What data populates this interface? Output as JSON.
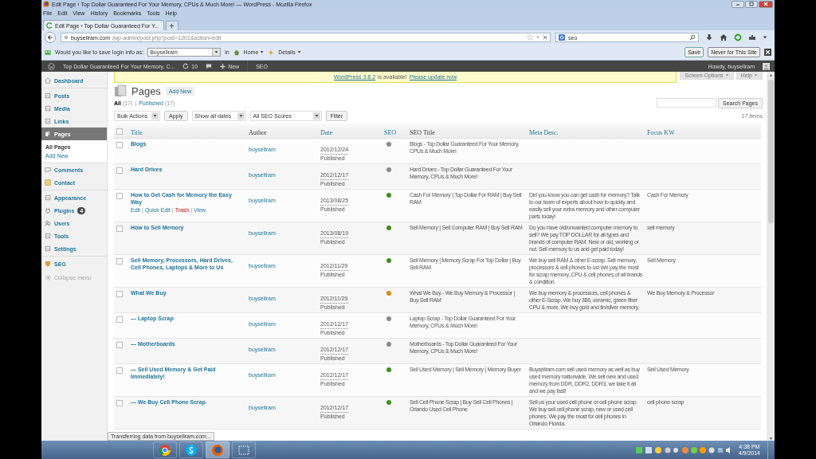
{
  "browser": {
    "title": "Edit Page ‹ Top Dollar Guaranteed For Your Memory, CPUs & Much More! — WordPress - Mozilla Firefox",
    "menu": [
      "File",
      "Edit",
      "View",
      "History",
      "Bookmarks",
      "Tools",
      "Help"
    ],
    "tab": {
      "label": "Edit Page ‹ Top Dollar Guaranteed For Y..."
    },
    "url": {
      "host": "buysellram.com",
      "path": "/wp-admin/post.php?post=1201&action=edit"
    },
    "search": {
      "value": "seo"
    }
  },
  "password_bar": {
    "prompt": "Would you like to save login info as:",
    "username": "Buysellram",
    "in": "in",
    "home": "Home",
    "details": "Details",
    "save": "Save",
    "never": "Never for This Site"
  },
  "admin_bar": {
    "site": "Top Dollar Guaranteed For Your Memory, C...",
    "updates": "10",
    "new": "New",
    "seo": "SEO",
    "howdy": "Howdy, buysellram"
  },
  "sidebar": {
    "groups": [
      {
        "items": [
          {
            "label": "Dashboard",
            "selected": false
          }
        ]
      },
      {
        "items": [
          {
            "label": "Posts",
            "selected": false
          },
          {
            "label": "Media",
            "selected": false
          },
          {
            "label": "Links",
            "selected": false
          },
          {
            "label": "Pages",
            "selected": true,
            "children": [
              {
                "label": "All Pages",
                "selected": true
              },
              {
                "label": "Add New",
                "selected": false
              }
            ]
          },
          {
            "label": "Comments",
            "selected": false
          },
          {
            "label": "Contact",
            "selected": false
          }
        ]
      },
      {
        "items": [
          {
            "label": "Appearance",
            "selected": false
          },
          {
            "label": "Plugins",
            "selected": false,
            "badge": "4"
          },
          {
            "label": "Users",
            "selected": false
          },
          {
            "label": "Tools",
            "selected": false
          },
          {
            "label": "Settings",
            "selected": false
          }
        ]
      },
      {
        "items": [
          {
            "label": "SEO",
            "selected": false
          }
        ]
      }
    ],
    "collapse": "Collapse menu"
  },
  "notice": {
    "version_link": "WordPress 3.8.2",
    "text": "is available!",
    "update_link": "Please update now"
  },
  "screen_options": "Screen Options",
  "help": "Help",
  "page": {
    "title": "Pages",
    "add_new": "Add New",
    "separator": "|",
    "views": [
      {
        "label": "All",
        "count": "(17)",
        "selected": true
      },
      {
        "label": "Published",
        "count": "(17)",
        "selected": false
      }
    ],
    "bulk": "Bulk Actions",
    "apply": "Apply",
    "dates": "Show all dates",
    "seo_filter": "All SEO Scores",
    "filter": "Filter",
    "search_button": "Search Pages",
    "items": "17 items"
  },
  "table": {
    "select_all_checked": false,
    "columns": [
      {
        "label": "Title",
        "sortable": true
      },
      {
        "label": "Author",
        "sortable": false
      },
      {
        "label": "Date",
        "sortable": true
      },
      {
        "label": "SEO",
        "sortable": true
      },
      {
        "label": "SEO Title",
        "sortable": false
      },
      {
        "label": "Meta Desc.",
        "sortable": true
      },
      {
        "label": "Focus KW",
        "sortable": true
      }
    ],
    "rows": [
      {
        "title": "Blogs",
        "checked": false,
        "author": "buysellram",
        "date": "2012/12/24",
        "status": "Published",
        "color": "#8a8a8a",
        "seo_title": "Blogs - Top Dollar Guaranteed For Your Memory, CPUs & Much More!"
      },
      {
        "title": "Hard Drives",
        "checked": false,
        "author": "buysellram",
        "date": "2012/12/17",
        "status": "Published",
        "color": "#8a8a8a",
        "seo_title": "Hard Drives - Top Dollar Guaranteed For Your Memory, CPUs & Much More!"
      },
      {
        "title": "How to Get Cash for Memory the Easy Way",
        "checked": false,
        "author": "buysellram",
        "date": "2013/08/25",
        "status": "Published",
        "color": "#3f8f1f",
        "seo_title": "Cash For Memory | Top Dollar For RAM | Buy Sell RAM",
        "meta": "Did you know you can get cash for memory? Talk to our team of experts about how to quickly and easily sell your extra memory and other computer parts today!",
        "focus": "Cash For Memory",
        "actions": [
          {
            "label": "Edit",
            "kind": "normal"
          },
          {
            "label": "Quick Edit",
            "kind": "normal"
          },
          {
            "label": "Trash",
            "kind": "danger"
          },
          {
            "label": "View",
            "kind": "normal"
          }
        ],
        "separator": "|"
      },
      {
        "title": "How to Sell Memory",
        "checked": false,
        "author": "buysellram",
        "date": "2013/08/19",
        "status": "Published",
        "color": "#3f8f1f",
        "seo_title": "Sell Memory | Sell Computer RAM | Buy Sell RAM",
        "meta": "Do you have old/unwanted computer memory to sell? We pay TOP DOLLAR for all types and brands of computer RAM. New or old, working or not. Sell memory to us and get paid today!",
        "focus": "sell memory"
      },
      {
        "title": "Sell Memory, Processors, Hard Drives, Cell Phones, Laptops & More to Us",
        "checked": false,
        "author": "buysellram",
        "date": "2012/11/29",
        "status": "Published",
        "color": "#3f8f1f",
        "seo_title": "Sell Memory | Memory Scrap For Top Dollar | Buy Sell RAM",
        "meta": "We buy sell RAM & other E-scrap. Sell memory, processors & cell phones to us! We pay the most for scrap memory, CPU & cell phones of all brands & condition.",
        "focus": "Sell Memory"
      },
      {
        "title": "What We Buy",
        "checked": false,
        "author": "buysellram",
        "date": "2012/11/29",
        "status": "Published",
        "color": "#d68a1c",
        "seo_title": "What We Buy - We Buy Memory & Processor | Buy Sell RAM",
        "meta": "We buy memory & processors, cell phones & other E-Scrap. We buy 386, ceramic, green fiber CPU & more. We buy gold and tin/silver memory.",
        "focus": "We Buy Memory & Processor"
      },
      {
        "title": "— Laptop Scrap",
        "checked": false,
        "author": "buysellram",
        "date": "2012/12/17",
        "status": "Published",
        "color": "#8a8a8a",
        "seo_title": "Laptop Scrap - Top Dollar Guaranteed For Your Memory, CPUs & Much More!"
      },
      {
        "title": "— Motherboards",
        "checked": false,
        "author": "buysellram",
        "date": "2012/12/17",
        "status": "Published",
        "color": "#8a8a8a",
        "seo_title": "Motherboards - Top Dollar Guaranteed For Your Memory, CPUs & Much More!"
      },
      {
        "title": "— Sell Used Memory & Get Paid Immediately!",
        "checked": false,
        "author": "buysellram",
        "date": "2012/12/17",
        "status": "Published",
        "color": "#3f8f1f",
        "seo_title": "Sell Used Memory | Sell Memory | Memory Buyer",
        "meta": "Buysellram.com sell used memory as well as buy used memory nationwide. We sell new and used memory from DDR, DDR2, DDR3, we take it all and we pay fast!",
        "focus": "Sell Used Memory"
      },
      {
        "title": "— We Buy Cell Phone Scrap",
        "checked": false,
        "author": "buysellram",
        "date": "2012/12/17",
        "status": "Published",
        "color": "#3f8f1f",
        "seo_title": "Sell Cell Phone Scrap | Buy Sell Cell Phones | Orlando Used Cell Phone",
        "meta": "Sell us your used cell phone or cell phone scrap. We buy sell cell phone scrap, new or used cell phones. We pay the most for cell phones in Orlando Florida.",
        "focus": "cell phone scrap"
      }
    ]
  },
  "status_text": "Transferring data from buysellram.com...",
  "taskbar": {
    "apps": [
      {
        "selected": false
      },
      {
        "selected": false
      },
      {
        "selected": true
      },
      {
        "selected": false
      }
    ],
    "time": "4:38 PM",
    "date": "4/9/2014"
  }
}
